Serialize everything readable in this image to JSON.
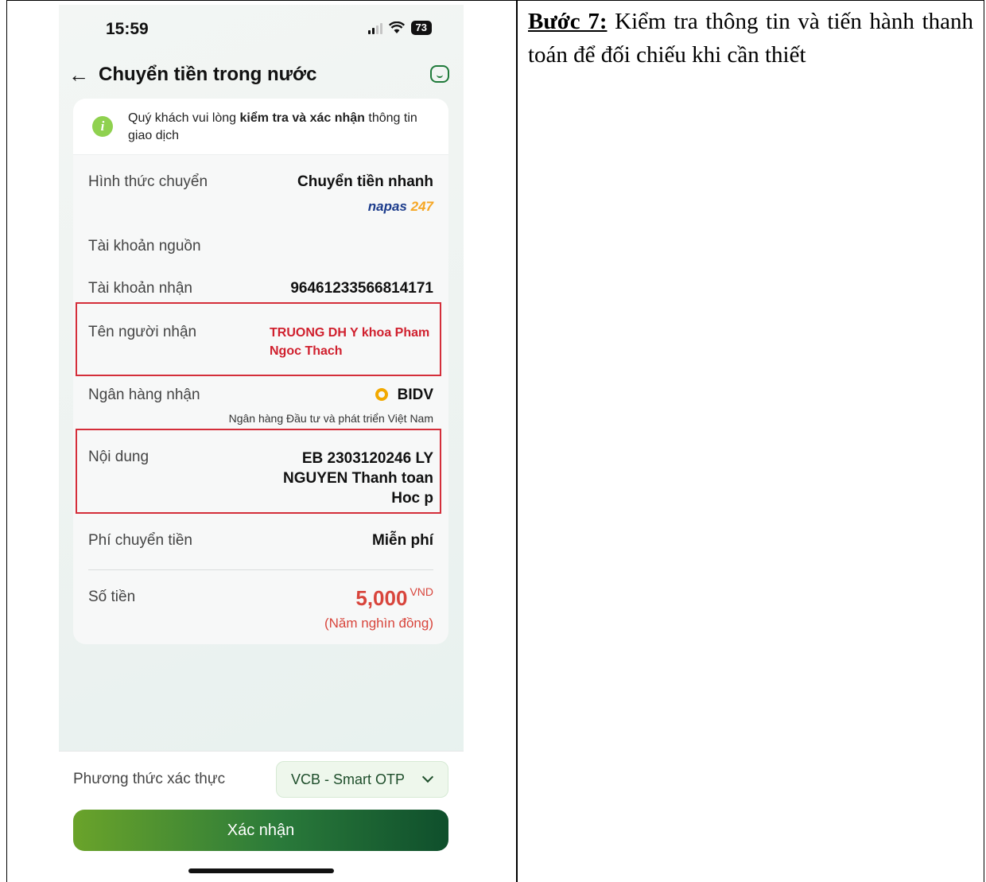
{
  "status_bar": {
    "time": "15:59",
    "battery": "73"
  },
  "header": {
    "title": "Chuyển tiền trong nước"
  },
  "notice": {
    "prefix": "Quý khách vui lòng ",
    "bold": "kiểm tra và xác nhận",
    "suffix": " thông tin giao dịch"
  },
  "rows": {
    "transfer_type": {
      "label": "Hình thức chuyển",
      "value": "Chuyển tiền nhanh",
      "napas_text": "napas",
      "napas_num": "247"
    },
    "source_account": {
      "label": "Tài khoản nguồn",
      "value": ""
    },
    "dest_account": {
      "label": "Tài khoản nhận",
      "value": "96461233566814171"
    },
    "recipient": {
      "label": "Tên người nhận",
      "value": "TRUONG DH Y khoa Pham Ngoc Thach"
    },
    "bank": {
      "label": "Ngân hàng nhận",
      "value": "BIDV",
      "full_name": "Ngân hàng Đầu tư và phát triển Việt Nam"
    },
    "content": {
      "label": "Nội dung",
      "value": "EB 2303120246 LY NGUYEN Thanh toan Hoc p"
    },
    "fee": {
      "label": "Phí chuyển tiền",
      "value": "Miễn phí"
    },
    "amount": {
      "label": "Số tiền",
      "value": "5,000",
      "currency": "VND",
      "words": "(Năm nghìn đồng)"
    }
  },
  "auth": {
    "label": "Phương thức xác thực",
    "selected": "VCB - Smart OTP"
  },
  "confirm_label": "Xác nhận",
  "doc": {
    "step_label": "Bước 7:",
    "step_text": " Kiểm tra thông tin và tiến hành thanh toán để đối chiếu khi cần thiết"
  },
  "colors": {
    "accent_green": "#2a7a3a",
    "highlight_red": "#d42e3a",
    "amount_red": "#d8453c"
  }
}
